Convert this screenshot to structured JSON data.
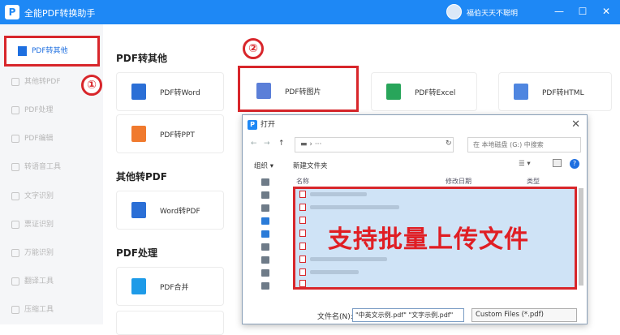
{
  "app": {
    "title": "全能PDF转换助手",
    "username": "福伯天天不聪明",
    "logo_text": "P"
  },
  "window": {
    "minimize": "—",
    "maximize": "☐",
    "close": "✕"
  },
  "sidebar": {
    "items": [
      {
        "label": "PDF转其他",
        "active": true
      },
      {
        "label": "其他转PDF"
      },
      {
        "label": "PDF处理"
      },
      {
        "label": "PDF编辑"
      },
      {
        "label": "转语音工具"
      },
      {
        "label": "文字识别"
      },
      {
        "label": "票证识别"
      },
      {
        "label": "万能识别"
      },
      {
        "label": "翻译工具"
      },
      {
        "label": "压缩工具"
      }
    ]
  },
  "annotations": {
    "circle1": "①",
    "circle2": "②",
    "overlay_text": "支持批量上传文件"
  },
  "sections": [
    {
      "title": "PDF转其他",
      "cards": [
        "PDF转Word",
        "PDF转图片",
        "PDF转Excel",
        "PDF转HTML",
        "PDF转PPT"
      ]
    },
    {
      "title": "其他转PDF",
      "cards": [
        "Word转PDF"
      ]
    },
    {
      "title": "PDF处理",
      "cards": [
        "PDF合并"
      ]
    }
  ],
  "dialog": {
    "title": "打开",
    "icon": "P",
    "close": "✕",
    "address": "▬ › ···",
    "search_placeholder": "在 本地磁盘 (G:) 中搜索",
    "organize": "组织 ▾",
    "new_folder": "新建文件夹",
    "columns": [
      "名称",
      "修改日期",
      "类型"
    ],
    "filename_label": "文件名(N):",
    "filename_value": "\"中英文示例.pdf\" \"文字示例.pdf\"",
    "filetype": "Custom Files (*.pdf)",
    "nav": {
      "back": "←",
      "forward": "→",
      "up": "↑",
      "refresh": "↻",
      "view": "☰ ▾",
      "help": "?"
    }
  },
  "colors": {
    "accent": "#1e88f5",
    "highlight": "#d8262b",
    "overlay_bg": "#cfe3f6"
  }
}
